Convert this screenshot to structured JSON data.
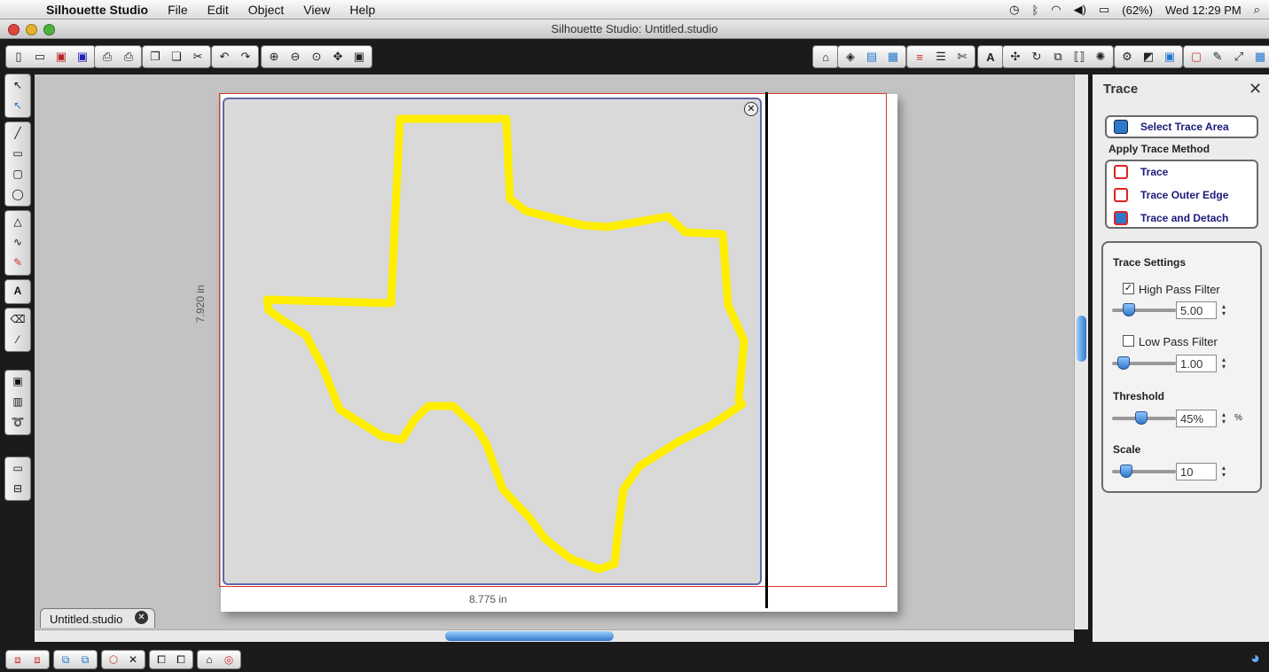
{
  "menubar": {
    "app_name": "Silhouette Studio",
    "items": [
      "File",
      "Edit",
      "Object",
      "View",
      "Help"
    ],
    "battery": "(62%)",
    "clock": "Wed 12:29 PM"
  },
  "window": {
    "title": "Silhouette Studio: Untitled.studio"
  },
  "document": {
    "tab_label": "Untitled.studio",
    "height_label": "7.920 in",
    "width_label": "8.775 in"
  },
  "trace_panel": {
    "title": "Trace",
    "select_area_label": "Select Trace Area",
    "apply_method_heading": "Apply Trace Method",
    "methods": [
      "Trace",
      "Trace Outer Edge",
      "Trace and Detach"
    ],
    "settings_heading": "Trace Settings",
    "high_pass": {
      "label": "High Pass Filter",
      "checked": true,
      "value": "5.00",
      "level": 0.2
    },
    "low_pass": {
      "label": "Low Pass Filter",
      "checked": false,
      "value": "1.00",
      "level": 0.1
    },
    "threshold": {
      "label": "Threshold",
      "value": "45%",
      "unit": "%",
      "level": 0.45
    },
    "scale": {
      "label": "Scale",
      "value": "10",
      "level": 0.15
    }
  },
  "colors": {
    "trace_outline": "#ffee00",
    "cut_border": "#dd3333",
    "accent": "#2f78c8"
  }
}
